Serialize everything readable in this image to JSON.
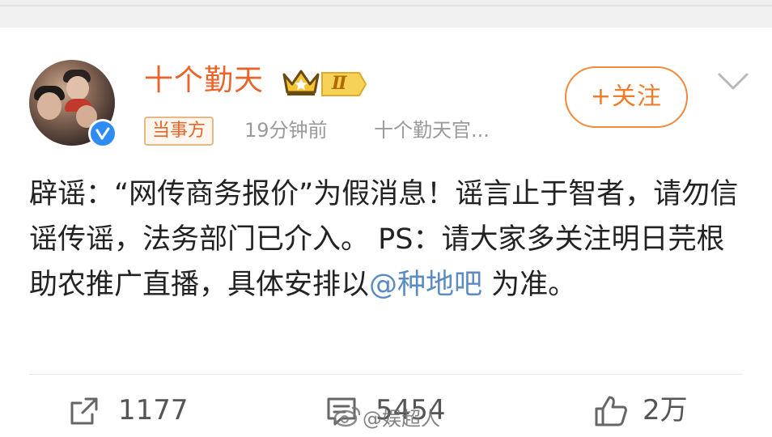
{
  "post": {
    "username": "十个勤天",
    "level": "Ⅱ",
    "role_badge": "当事方",
    "time": "19分钟前",
    "source": "十个勤天官...",
    "follow_label": "+关注",
    "text_main": "辟谣：“网传商务报价”为假消息！谣言止于智者，请勿信谣传谣，法务部门已介入。 PS：请大家多关注明日芫根助农推广直播，具体安排以",
    "mention": "@种地吧",
    "text_tail": " 为准。"
  },
  "actions": {
    "repost_count": "1177",
    "comment_count": "5454",
    "like_count": "2万"
  },
  "watermark": {
    "text": "@娱超人"
  },
  "icons": {
    "verified": "verified-blue-icon",
    "crown": "crown-icon",
    "chevron": "chevron-down-icon",
    "repost": "repost-icon",
    "comment": "comment-icon",
    "like": "thumbs-up-icon",
    "weibo_logo": "weibo-logo-icon"
  },
  "colors": {
    "username": "#e8642b",
    "follow": "#f07c2a",
    "mention": "#5b8bc2",
    "verified": "#2f8cf3"
  }
}
